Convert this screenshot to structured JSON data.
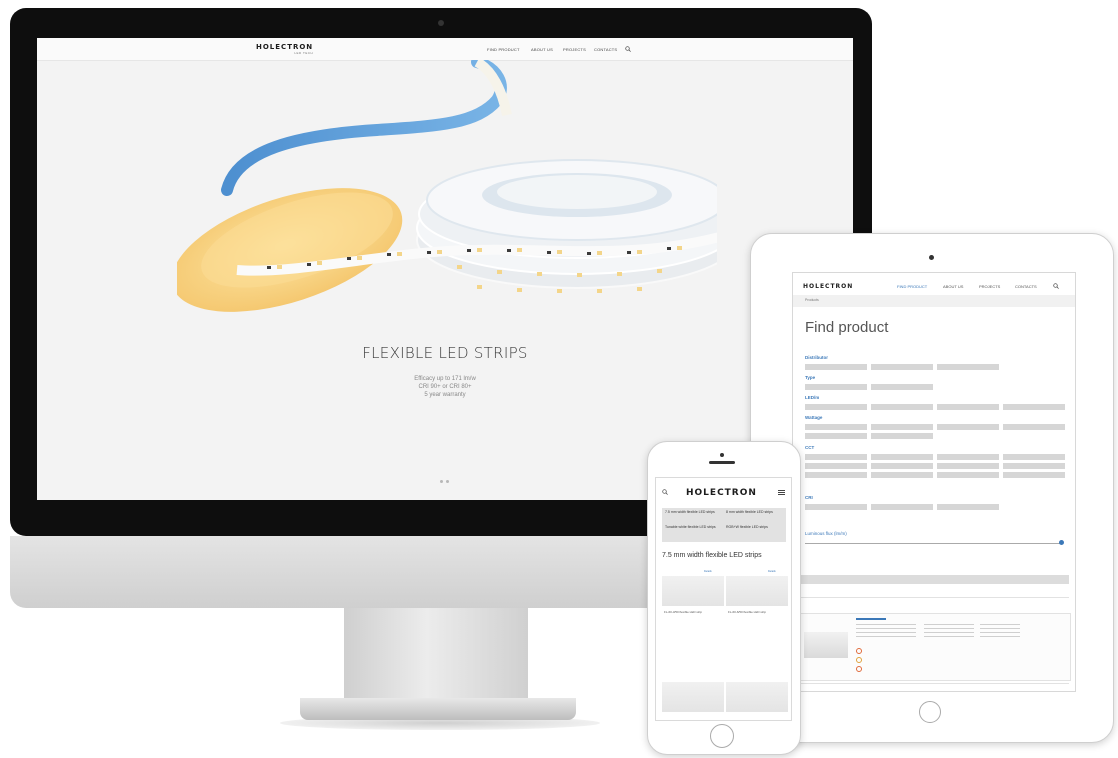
{
  "desktop": {
    "logo": "HOLECTRON",
    "logo_sub": "LED TECH",
    "nav": [
      "FIND PRODUCT",
      "ABOUT US",
      "PROJECTS",
      "CONTACTS"
    ],
    "hero": {
      "title": "FLEXIBLE LED STRIPS",
      "lines": [
        "Efficacy up to 171 lm/w",
        "CRI 90+ or CRI 80+",
        "5 year warranty"
      ]
    }
  },
  "tablet": {
    "logo": "HOLECTRON",
    "nav": [
      "FIND PRODUCT",
      "ABOUT US",
      "PROJECTS",
      "CONTACTS"
    ],
    "breadcrumb": "Products",
    "title": "Find product",
    "filters": [
      "Distributor",
      "Type",
      "LED/m",
      "Wattage",
      "CCT",
      "CRI"
    ],
    "table_label": "Luminous flux (lm/m)",
    "colors": {
      "accent": "#3b78b8",
      "chip": "#d6d6d6"
    }
  },
  "phone": {
    "logo": "HOLECTRON",
    "menu": [
      "7.5 mm width flexible LED strips",
      "8 mm width flexible LED strips",
      "Tunable white flexible LED strips",
      "RGB+W flexible LED strips"
    ],
    "title": "7.5 mm width flexible LED strips",
    "cards": [
      {
        "name": "FL-60-3/50 flexible LED strip",
        "link": "Details"
      },
      {
        "name": "FL-60-6/50 flexible LED strip",
        "link": "Details"
      }
    ]
  }
}
